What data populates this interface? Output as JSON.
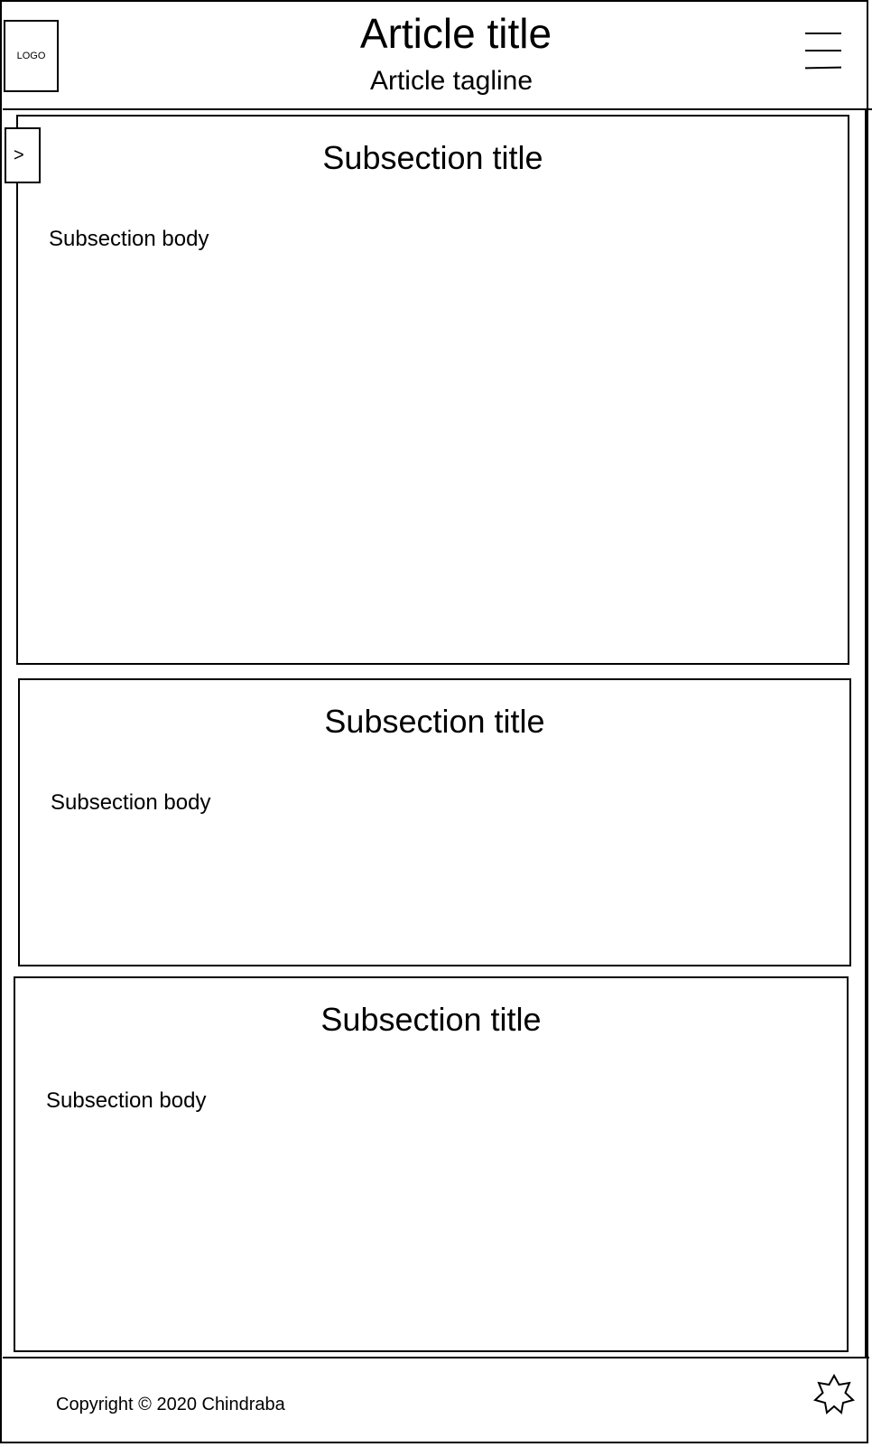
{
  "header": {
    "logo_label": "LOGO",
    "title": "Article title",
    "tagline": "Article tagline",
    "menu_icon": "hamburger-menu-icon"
  },
  "sidebar": {
    "toggle_label": ">"
  },
  "sections": [
    {
      "title": "Subsection title",
      "body": "Subsection body"
    },
    {
      "title": "Subsection title",
      "body": "Subsection body"
    },
    {
      "title": "Subsection title",
      "body": "Subsection body"
    }
  ],
  "footer": {
    "copyright": "Copyright © 2020 Chindraba",
    "icon": "star-icon"
  }
}
